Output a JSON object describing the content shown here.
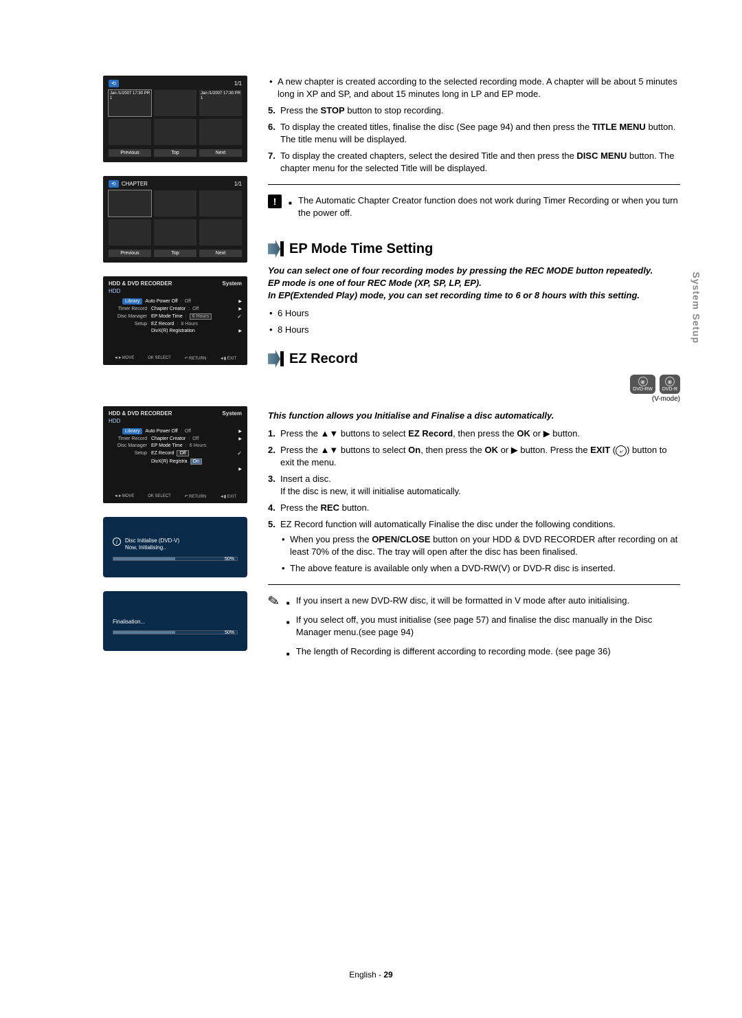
{
  "thumbs": {
    "title_header": "",
    "page": "1/1",
    "cell_labels": [
      "Jan /1/2007\n17:30 PR 1",
      "",
      "Jan /1/2007\n17:30 PR 1",
      "",
      "",
      ""
    ],
    "buttons": [
      "Previous",
      "Top",
      "Next"
    ],
    "chapter_header": "CHAPTER",
    "chapter_page": "1/1"
  },
  "menu1": {
    "head_left": "HDD & DVD RECORDER",
    "head_right": "System",
    "sub": "HDD",
    "left_items": [
      "Library",
      "Timer Record",
      "Disc Manager",
      "Setup"
    ],
    "rows": [
      {
        "label": "Auto Power Off",
        "val": "Off",
        "arrow": true
      },
      {
        "label": "Chapter Creator",
        "val": "Off",
        "arrow": true
      },
      {
        "label": "EP Mode Time",
        "val": "6 Hours",
        "hi": true,
        "check": true
      },
      {
        "label": "EZ Record",
        "val": "8 Hours",
        "hi_below": true
      },
      {
        "label": "DivX(R) Registration",
        "val": "",
        "arrow": true
      }
    ],
    "footer": [
      "◄►MOVE",
      "OK SELECT",
      "↶ RETURN",
      "◄▮ EXIT"
    ]
  },
  "menu2": {
    "rows": [
      {
        "label": "Auto Power Off",
        "val": "Off",
        "arrow": true
      },
      {
        "label": "Chapter Creator",
        "val": "Off",
        "arrow": true
      },
      {
        "label": "EP Mode Time",
        "val": "6 Hours"
      },
      {
        "label": "EZ Record",
        "val": ""
      },
      {
        "label": "DivX(R) Registra",
        "val": ""
      }
    ],
    "dropdown": [
      "Off",
      "On"
    ]
  },
  "init": {
    "text1": "Disc Initialise (DVD-V)",
    "text2": "Now, Initialising..",
    "pct": "50%"
  },
  "final": {
    "text": "Finalisation...",
    "pct": "50%"
  },
  "right": {
    "top_bullets": [
      "A new chapter is created according to the selected recording mode. A chapter will be about 5 minutes long in XP and SP, and about 15 minutes long in LP and EP mode."
    ],
    "top_nums": [
      {
        "n": "5.",
        "prefix": "Press the ",
        "bold1": "STOP",
        "rest": " button to stop recording."
      },
      {
        "n": "6.",
        "text": "To display the created titles, finalise the disc (See page 94) and then press the ",
        "bold1": "TITLE MENU",
        "rest": " button. The title menu will be displayed."
      },
      {
        "n": "7.",
        "text": "To display the created chapters, select the desired Title and then press the ",
        "bold1": "DISC MENU",
        "rest": " button. The chapter menu for the selected Title will be displayed."
      }
    ],
    "alert_note": "The Automatic Chapter Creator function does not work during Timer Recording or when you turn the power off.",
    "sec1_title": "EP Mode Time Setting",
    "sec1_intro": [
      "You can select one of four recording modes by pressing the REC MODE button repeatedly.",
      "EP mode is one of four REC Mode (XP, SP, LP, EP).",
      "In EP(Extended Play) mode, you can set recording time to 6 or 8 hours with this setting."
    ],
    "sec1_bullets": [
      "6 Hours",
      "8 Hours"
    ],
    "sec2_title": "EZ Record",
    "media_badges": [
      {
        "label": "DVD-RW"
      },
      {
        "label": "DVD-R"
      }
    ],
    "media_caption": "(V-mode)",
    "sec2_intro": "This function allows you Initialise and Finalise a disc automatically.",
    "sec2_nums": [
      {
        "n": "1.",
        "html": "Press the ▲▼ buttons to select <b>EZ Record</b>, then press the <b>OK</b> or ▶ button."
      },
      {
        "n": "2.",
        "html": "Press the ▲▼ buttons to select <b>On</b>, then press the <b>OK</b> or ▶ button. Press the <b>EXIT</b> (<span class='exit-btn-inline' data-name='exit-circle-icon' data-interactable='false'>⤶</span>) button to exit the menu."
      },
      {
        "n": "3.",
        "html": "Insert a disc.<br>If the disc is new, it will initialise automatically."
      },
      {
        "n": "4.",
        "html": "Press the <b>REC</b> button."
      },
      {
        "n": "5.",
        "html": "EZ Record function will automatically Finalise the disc under the following conditions.",
        "subs": [
          "When you press the <b>OPEN/CLOSE</b> button on your HDD & DVD RECORDER after recording on at least 70% of the disc. The tray will open after the disc has been finalised.",
          "The above feature is available only when a DVD-RW(V) or DVD-R disc is inserted."
        ]
      }
    ],
    "pencil_notes": [
      "If you insert a new DVD-RW disc, it will be formatted in V mode after auto initialising.",
      "If you select off, you must initialise (see page 57) and finalise the disc manually in the Disc Manager menu.(see page 94)",
      "The length of Recording is different according to recording mode. (see page 36)"
    ]
  },
  "side_tab": "System Setup",
  "footer": {
    "lang": "English - ",
    "page": "29"
  }
}
